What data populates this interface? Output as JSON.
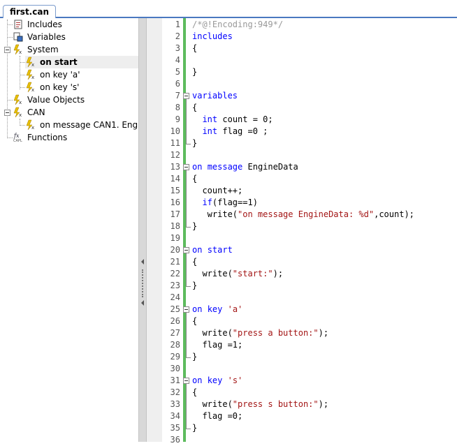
{
  "tab": {
    "label": "first.can"
  },
  "tree": {
    "items": [
      {
        "label": "Includes",
        "icon": "includes-icon"
      },
      {
        "label": "Variables",
        "icon": "variables-icon"
      },
      {
        "label": "System",
        "icon": "system-function-icon"
      },
      {
        "label": "on start",
        "icon": "event-icon"
      },
      {
        "label": "on key 'a'",
        "icon": "event-icon"
      },
      {
        "label": "on key 's'",
        "icon": "event-icon"
      },
      {
        "label": "Value Objects",
        "icon": "value-objects-icon"
      },
      {
        "label": "CAN",
        "icon": "can-function-icon"
      },
      {
        "label": "on message CAN1. Eng...",
        "icon": "event-icon"
      },
      {
        "label": "Functions",
        "icon": "functions-icon"
      }
    ]
  },
  "code": {
    "line_numbers": [
      "1",
      "2",
      "3",
      "4",
      "5",
      "6",
      "7",
      "8",
      "9",
      "10",
      "11",
      "12",
      "13",
      "14",
      "15",
      "16",
      "17",
      "18",
      "19",
      "20",
      "21",
      "22",
      "23",
      "24",
      "25",
      "26",
      "27",
      "28",
      "29",
      "30",
      "31",
      "32",
      "33",
      "34",
      "35",
      "36"
    ],
    "lines": [
      "/*@!Encoding:949*/",
      "includes",
      "{",
      "",
      "}",
      "",
      "variables",
      "{",
      "  int count = 0;",
      "  int flag =0 ;",
      "}",
      "",
      "on message EngineData",
      "{",
      "  count++;",
      "  if(flag==1)",
      "   write(\"on message EngineData: %d\",count);",
      "}",
      "",
      "on start",
      "{",
      "  write(\"start:\");",
      "}",
      "",
      "on key 'a'",
      "{",
      "  write(\"press a button:\");",
      "  flag =1;",
      "}",
      "",
      "on key 's'",
      "{",
      "  write(\"press s button:\");",
      "  flag =0;",
      "}",
      "",
      ""
    ]
  },
  "colors": {
    "keyword": "#0000ff",
    "string": "#a31515",
    "comment": "#999999",
    "change_bar": "#5dbb5d"
  }
}
